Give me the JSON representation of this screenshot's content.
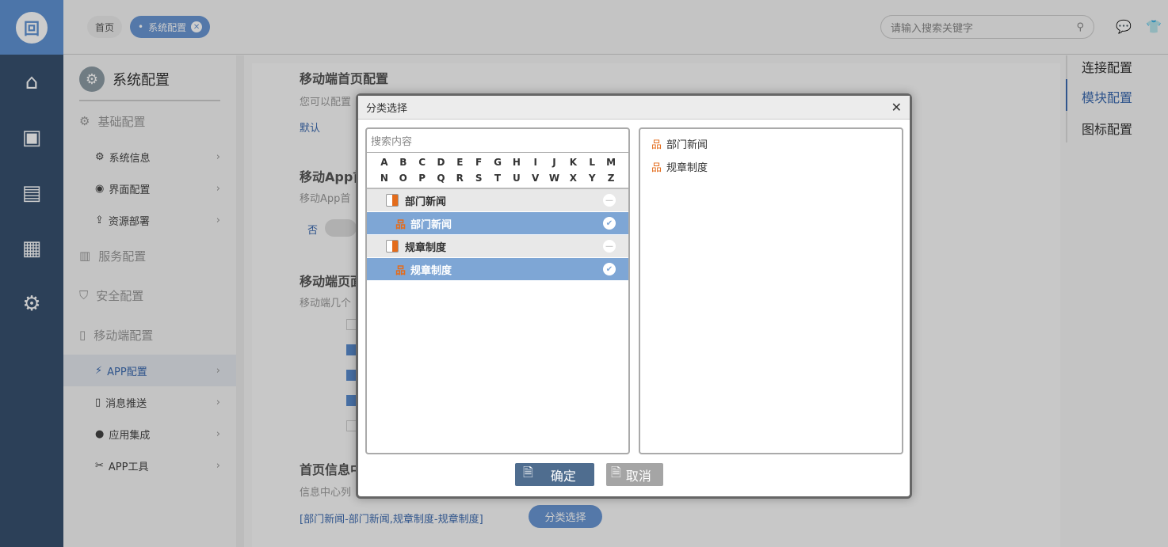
{
  "header": {
    "tabs": [
      {
        "label": "首页"
      },
      {
        "label": "系统配置"
      }
    ],
    "search_placeholder": "请输入搜索关键字"
  },
  "sidebar": {
    "title": "系统配置",
    "sections": [
      {
        "label": "基础配置",
        "items": [
          {
            "label": "系统信息"
          },
          {
            "label": "界面配置"
          },
          {
            "label": "资源部署"
          }
        ]
      },
      {
        "label": "服务配置"
      },
      {
        "label": "安全配置"
      },
      {
        "label": "移动端配置",
        "items": [
          {
            "label": "APP配置"
          },
          {
            "label": "消息推送"
          },
          {
            "label": "应用集成"
          },
          {
            "label": "APP工具"
          }
        ]
      }
    ]
  },
  "main": {
    "s1_title": "移动端首页配置",
    "s1_desc": "您可以配置",
    "s1_link": "默认",
    "s2_title": "移动App首",
    "s2_desc": "移动App首",
    "s2_toggle": "否",
    "s3_title": "移动端页面",
    "s3_desc": "移动端几个",
    "s4_title": "首页信息中",
    "s4_desc": "信息中心列",
    "s4_value": "[部门新闻-部门新闻,规章制度-规章制度]",
    "s4_button": "分类选择"
  },
  "right_nav": {
    "items": [
      "连接配置",
      "模块配置",
      "图标配置"
    ],
    "active": "模块配置"
  },
  "dialog": {
    "title": "分类选择",
    "search_placeholder": "搜索内容",
    "letters": [
      "A",
      "B",
      "C",
      "D",
      "E",
      "F",
      "G",
      "H",
      "I",
      "J",
      "K",
      "L",
      "M",
      "N",
      "O",
      "P",
      "Q",
      "R",
      "S",
      "T",
      "U",
      "V",
      "W",
      "X",
      "Y",
      "Z"
    ],
    "tree": [
      {
        "group": "部门新闻",
        "child": "部门新闻",
        "selected": true
      },
      {
        "group": "规章制度",
        "child": "规章制度",
        "selected": true
      }
    ],
    "selected": [
      "部门新闻",
      "规章制度"
    ],
    "ok": "确定",
    "cancel": "取消"
  },
  "colors": {
    "accent": "#6093d4",
    "selected_row": "#7ea6d5",
    "rail": "#37506e"
  }
}
